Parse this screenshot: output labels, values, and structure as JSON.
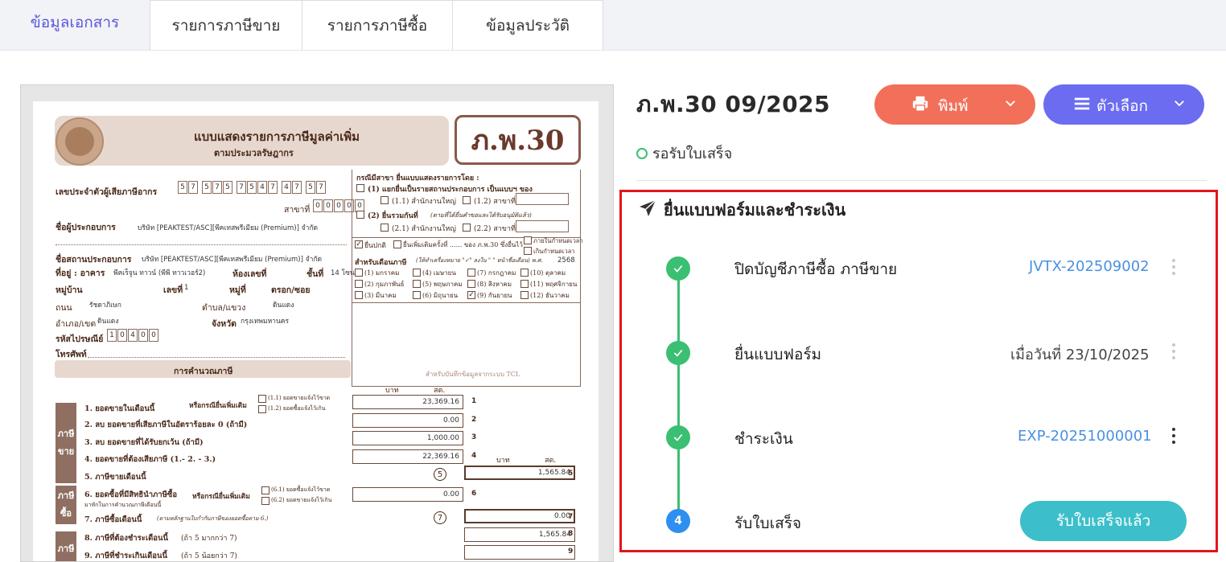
{
  "tabs": [
    {
      "label": "ข้อมูลเอกสาร"
    },
    {
      "label": "รายการภาษีขาย"
    },
    {
      "label": "รายการภาษีซื้อ"
    },
    {
      "label": "ข้อมูลประวัติ"
    }
  ],
  "header": {
    "title": "ภ.พ.30 09/2025",
    "print_label": "พิมพ์",
    "options_label": "ตัวเลือก",
    "status": "รอรับใบเสร็จ",
    "colors": {
      "print": "#f26f5a",
      "options": "#6b6cf0",
      "status": "#3bbf72"
    }
  },
  "process": {
    "title": "ยื่นแบบฟอร์มและชำระเงิน",
    "steps": [
      {
        "number": "1",
        "label": "ปิดบัญชีภาษีซื้อ ภาษีขาย",
        "value": "JVTX-202509002",
        "state": "done"
      },
      {
        "number": "2",
        "label": "ยื่นแบบฟอร์ม",
        "value": "เมื่อวันที่ 23/10/2025",
        "state": "done"
      },
      {
        "number": "3",
        "label": "ชำระเงิน",
        "value": "EXP-20251000001",
        "state": "done"
      },
      {
        "number": "4",
        "label": "รับใบเสร็จ",
        "button": "รับใบเสร็จแล้ว",
        "state": "current"
      }
    ]
  },
  "form": {
    "code": "ภ.พ.30",
    "title": "แบบแสดงรายการภาษีมูลค่าเพิ่ม",
    "subtitle": "ตามประมวลรัษฎากร",
    "tax_id_label": "เลขประจำตัวผู้เสียภาษีอากร",
    "tax_id": [
      "5",
      "7",
      "5",
      "7",
      "5",
      "7",
      "5",
      "4",
      "7",
      "4",
      "7",
      "5",
      "7"
    ],
    "branch_label": "สาขาที่",
    "branch": [
      "0",
      "0",
      "0",
      "0",
      "0"
    ],
    "operator_label": "ชื่อผู้ประกอบการ",
    "operator_value": "บริษัท [PEAKTEST/ASC][พีคเทสพรีเมียม (Premium)] จำกัด",
    "place_label": "ชื่อสถานประกอบการ",
    "place_value": "บริษัท [PEAKTEST/ASC][พีคเทสพรีเมียม (Premium)] จำกัด",
    "address_label": "ที่อยู่ : อาคาร",
    "building": "พีคเร็จูน ทาวน์ (พีพี ทาวเวอร์2)",
    "room_label": "ห้องเลขที่",
    "floor_label": "ชั้นที่",
    "floor": "14 โซน D",
    "village_label": "หมู่บ้าน",
    "no_label": "เลขที่",
    "no": "1",
    "moo_label": "หมู่ที่",
    "soi_label": "ตรอก/ซอย",
    "road_label": "ถนน",
    "road": "รัชดาภิเษก",
    "subdistrict_label": "ตำบล/แขวง",
    "subdistrict": "ดินแดง",
    "district_label": "อำเภอ/เขต",
    "district": "ดินแดง",
    "province_label": "จังหวัด",
    "province": "กรุงเทพมหานคร",
    "postcode_label": "รหัสไปรษณีย์",
    "postcode": [
      "1",
      "0",
      "4",
      "0",
      "0"
    ],
    "phone_label": "โทรศัพท์",
    "calc_header": "การคำนวณภาษี",
    "branch_case_title": "กรณีมีสาขา ยื่นแบบแสดงรายการโดย :",
    "branch_case_1": "(1) แยกยื่นเป็นรายสถานประกอบการ เป็นแบบฯ ของ",
    "branch_case_1_1": "(1.1) สำนักงานใหญ่",
    "branch_case_1_2": "(1.2) สาขาที่",
    "branch_case_2": "(2) ยื่นรวมกันที่",
    "branch_case_2_note": "(ตามที่ได้ยื่นคำขอและได้รับอนุมัติแล้ว)",
    "branch_case_2_1": "(2.1) สำนักงานใหญ่",
    "branch_case_2_2": "(2.2) สาขาที่",
    "filing_normal": "ยื่นปกติ",
    "filing_additional": "ยื่นเพิ่มเติมครั้งที่ ...... ของ ภ.พ.30 ซึ่งยื่นไว้",
    "filing_on_time": "ภายในกำหนดเวลา",
    "filing_late": "เกินกำหนดเวลา",
    "month_title": "สำหรับเดือนภาษี",
    "month_note": "(ให้ทำเครื่องหมาย \"✓\" ลงใน \" \" หน้าชื่อเดือน) พ.ศ.",
    "year": "2568",
    "months": [
      "(1) มกราคม",
      "(4) เมษายน",
      "(7) กรกฎาคม",
      "(10) ตุลาคม",
      "(2) กุมภาพันธ์",
      "(5) พฤษภาคม",
      "(8) สิงหาคม",
      "(11) พฤศจิกายน",
      "(3) มีนาคม",
      "(6) มิถุนายน",
      "(9) กันยายน",
      "(12) ธันวาคม"
    ],
    "tcl_note": "สำหรับบันทึกข้อมูลจากระบบ TCL",
    "col_baht": "บาท",
    "col_satang": "สต.",
    "side_sales": "ภาษี\nขาย",
    "side_purchase": "ภาษี\nซื้อ",
    "side_net": "ภาษี\nมูลค่า",
    "rows": [
      {
        "no": "1",
        "label": "1. ยอดขายในเดือนนี้",
        "amount": "23,369.16"
      },
      {
        "no": "2",
        "label": "2. ลบ ยอดขายที่เสียภาษีในอัตราร้อยละ 0 (ถ้ามี)",
        "amount": "0.00"
      },
      {
        "no": "3",
        "label": "3. ลบ ยอดขายที่ได้รับยกเว้น (ถ้ามี)",
        "amount": "1,000.00"
      },
      {
        "no": "4",
        "label": "4. ยอดขายที่ต้องเสียภาษี (1.- 2. - 3.)",
        "amount": "22,369.16"
      },
      {
        "no": "5",
        "label": "5. ภาษีขายเดือนนี้",
        "amount": "1,565.84"
      },
      {
        "no": "6",
        "label": "6. ยอดซื้อที่มีสิทธินำภาษีซื้อ",
        "amount": "0.00"
      },
      {
        "no": "7",
        "label": "7. ภาษีซื้อเดือนนี้",
        "amount": "0.00"
      },
      {
        "no": "8",
        "label": "8. ภาษีที่ต้องชำระเดือนนี้",
        "amount": "1,565.84"
      },
      {
        "no": "9",
        "label": "9. ภาษีที่ชำระเกินเดือนนี้",
        "amount": ""
      }
    ],
    "row6_sub": "มาหักในการคำนวณภาษีเดือนนี้",
    "row7_note": "(ตามหลักฐานใบกำกับภาษีของยอดซื้อตาม 6.)",
    "row8_note": "(ถ้า 5 มากกว่า 7)",
    "row9_note": "(ถ้า 5 น้อยกว่า 7)",
    "extra_sales_label": "หรือกรณียื่นเพิ่มเติม",
    "extra_1_1": "(1.1) ยอดขายแจ้งไว้ขาด",
    "extra_1_2": "(1.2) ยอดซื้อแจ้งไว้เกิน",
    "extra_6_1": "(6.1) ยอดซื้อแจ้งไว้ขาด",
    "extra_6_2": "(6.2) ยอดขายแจ้งไว้เกิน"
  }
}
